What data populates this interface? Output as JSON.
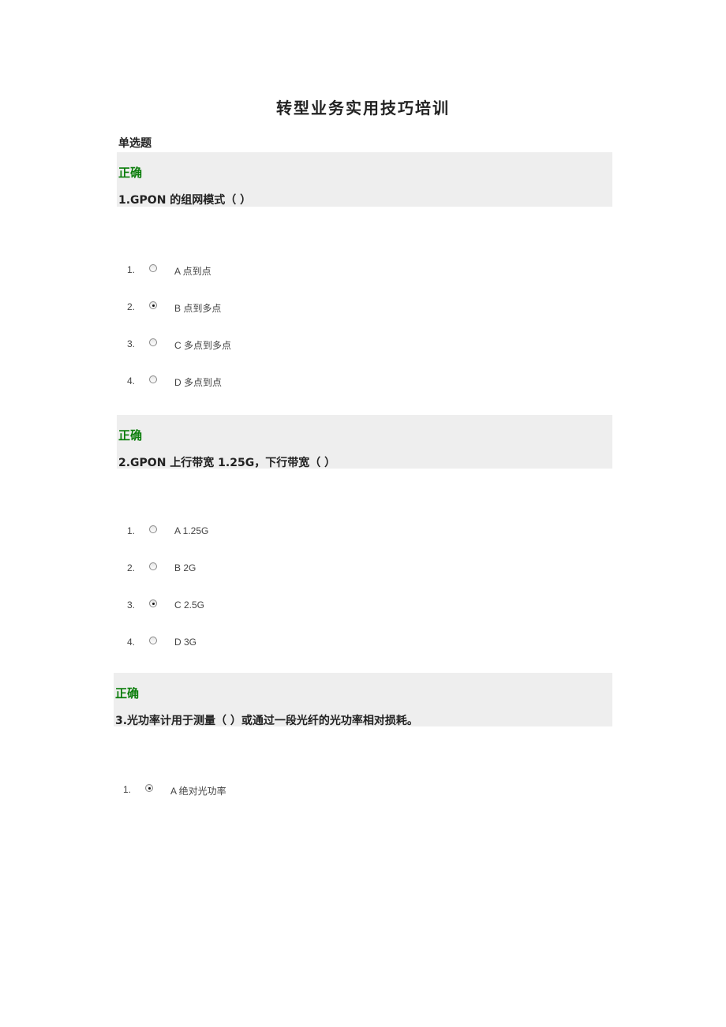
{
  "title": "转型业务实用技巧培训",
  "section_label": "单选题",
  "colors": {
    "correct": "#0a7d0a",
    "block_bg": "#eeeeee"
  },
  "questions": [
    {
      "status": "正确",
      "text": "1.GPON 的组网模式（ ）",
      "options": [
        {
          "num": "1.",
          "label": "A 点到点",
          "checked": false
        },
        {
          "num": "2.",
          "label": "B 点到多点",
          "checked": true
        },
        {
          "num": "3.",
          "label": "C 多点到多点",
          "checked": false
        },
        {
          "num": "4.",
          "label": "D 多点到点",
          "checked": false
        }
      ]
    },
    {
      "status": "正确",
      "text": "2.GPON 上行带宽 1.25G，下行带宽（ ）",
      "options": [
        {
          "num": "1.",
          "label": "A 1.25G",
          "checked": false
        },
        {
          "num": "2.",
          "label": "B 2G",
          "checked": false
        },
        {
          "num": "3.",
          "label": "C 2.5G",
          "checked": true
        },
        {
          "num": "4.",
          "label": "D 3G",
          "checked": false
        }
      ]
    },
    {
      "status": "正确",
      "text": "3.光功率计用于测量（ ）或通过一段光纤的光功率相对损耗。",
      "options": [
        {
          "num": "1.",
          "label": "A 绝对光功率",
          "checked": true
        }
      ]
    }
  ]
}
